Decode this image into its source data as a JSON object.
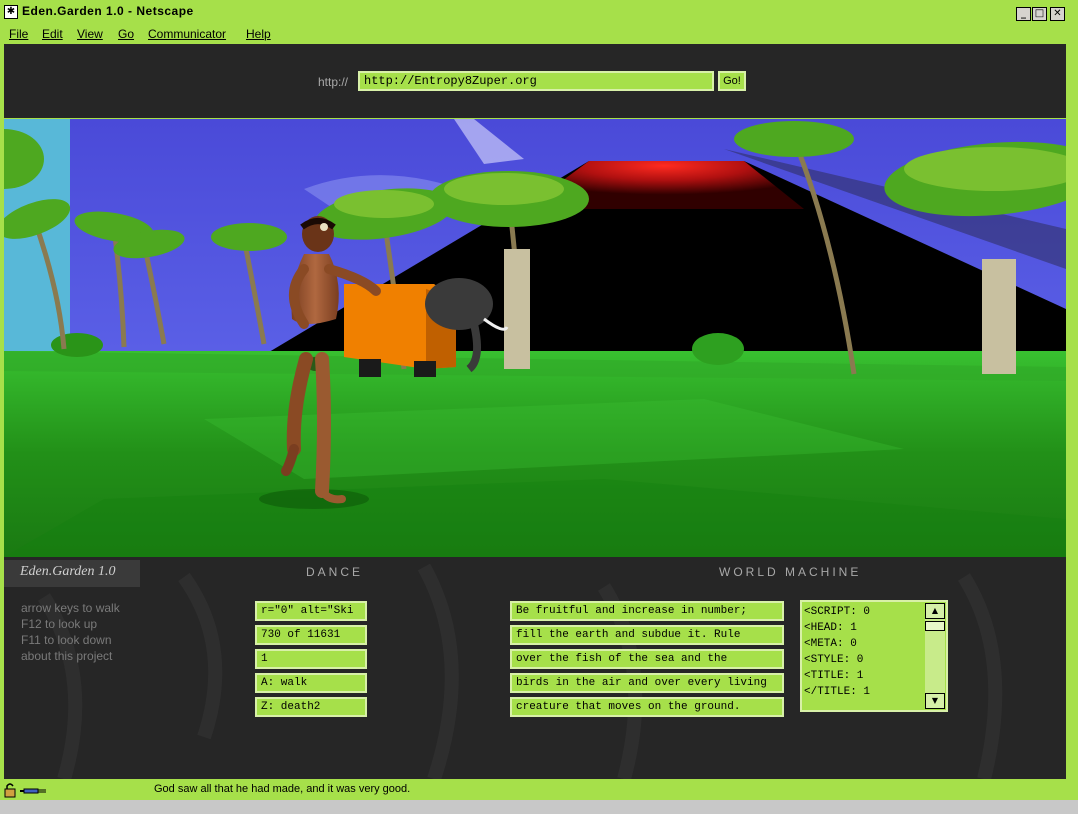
{
  "window": {
    "title": "Eden.Garden 1.0 - Netscape"
  },
  "menu": [
    "File",
    "Edit",
    "View",
    "Go",
    "Communicator",
    "Help"
  ],
  "address": {
    "prefix": "http://",
    "value": "http://Entropy8Zuper.org",
    "go_label": "Go!"
  },
  "panel": {
    "logo": "Eden.Garden 1.0",
    "dance_label": "DANCE",
    "world_label": "WORLD MACHINE",
    "help": [
      "arrow keys to walk",
      "F12 to look up",
      "F11 to look down",
      "about this project"
    ],
    "fields": [
      "r=\"0\" alt=\"Ski",
      "730 of 11631",
      "1",
      "A: walk",
      "Z: death2"
    ],
    "verse": [
      "Be fruitful and increase in number;",
      "fill the earth and subdue it. Rule",
      "over the fish of the sea and the",
      "birds in the air and over every living",
      "creature that moves on the ground."
    ],
    "tags": [
      "<SCRIPT: 0",
      "<HEAD: 1",
      "<META: 0",
      "<STYLE: 0",
      "<TITLE: 1",
      "</TITLE: 1"
    ]
  },
  "status": {
    "text": "God saw all that he had made, and it was very good."
  },
  "colors": {
    "chrome": "#a6e04a",
    "panel": "#262626",
    "field": "#a6e04a"
  }
}
